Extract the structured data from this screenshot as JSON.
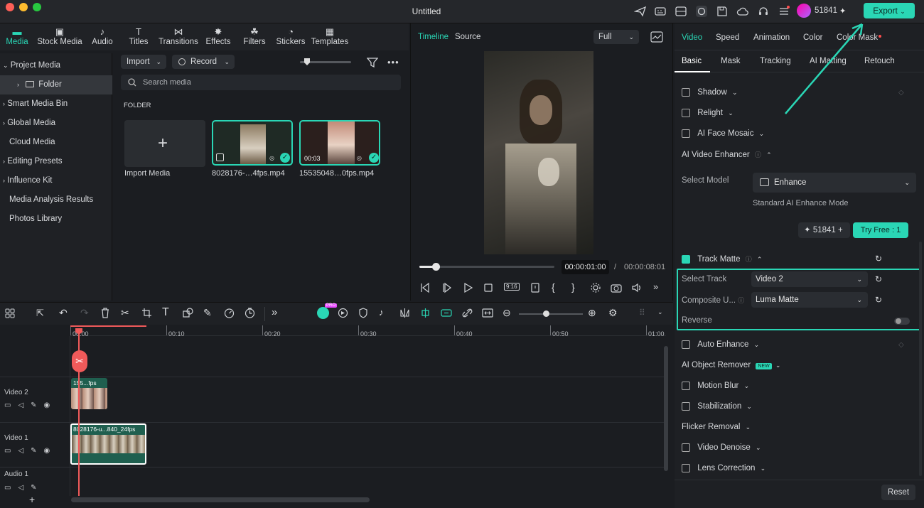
{
  "window": {
    "title": "Untitled",
    "credits": "51841",
    "export_label": "Export"
  },
  "media_tabs": [
    {
      "label": "Media",
      "icon": "folder-icon",
      "active": true
    },
    {
      "label": "Stock Media",
      "icon": "stock-icon"
    },
    {
      "label": "Audio",
      "icon": "music-icon"
    },
    {
      "label": "Titles",
      "icon": "text-icon"
    },
    {
      "label": "Transitions",
      "icon": "transition-icon"
    },
    {
      "label": "Effects",
      "icon": "effects-icon"
    },
    {
      "label": "Filters",
      "icon": "filters-icon"
    },
    {
      "label": "Stickers",
      "icon": "sticker-icon"
    },
    {
      "label": "Templates",
      "icon": "templates-icon"
    }
  ],
  "sidebar": [
    {
      "label": "Project Media"
    },
    {
      "label": "Folder"
    },
    {
      "label": "Smart Media Bin"
    },
    {
      "label": "Global Media"
    },
    {
      "label": "Cloud Media"
    },
    {
      "label": "Editing Presets"
    },
    {
      "label": "Influence Kit"
    },
    {
      "label": "Media Analysis Results"
    },
    {
      "label": "Photos Library"
    }
  ],
  "media": {
    "import_label": "Import",
    "record_label": "Record",
    "search_placeholder": "Search media",
    "folder_heading": "FOLDER",
    "import_media_label": "Import Media",
    "items": [
      {
        "name": "8028176-…4fps.mp4",
        "duration": ""
      },
      {
        "name": "15535048…0fps.mp4",
        "duration": "00:03"
      }
    ]
  },
  "player": {
    "tab_timeline": "Timeline",
    "tab_source": "Source",
    "quality": "Full",
    "current_time": "00:00:01:00",
    "separator": "/",
    "total_time": "00:00:08:01",
    "progress": 0.12
  },
  "inspector": {
    "top_tabs": [
      "Video",
      "Speed",
      "Animation",
      "Color",
      "Color Mask"
    ],
    "sub_tabs": [
      "Basic",
      "Mask",
      "Tracking",
      "AI Matting",
      "Retouch"
    ],
    "shadow": "Shadow",
    "relight": "Relight",
    "ai_face_mosaic": "AI Face Mosaic",
    "ai_video_enhancer": "AI Video Enhancer",
    "select_model_label": "Select Model",
    "model_value": "Enhance",
    "model_desc": "Standard AI Enhance Mode",
    "credits": "51841",
    "try_free": "Try Free : 1",
    "track_matte": "Track Matte",
    "select_track_label": "Select Track",
    "select_track_value": "Video 2",
    "composite_label": "Composite U...",
    "composite_value": "Luma Matte",
    "reverse_label": "Reverse",
    "auto_enhance": "Auto Enhance",
    "ai_object_remover": "AI Object Remover",
    "new_badge": "NEW",
    "motion_blur": "Motion Blur",
    "stabilization": "Stabilization",
    "flicker_removal": "Flicker Removal",
    "video_denoise": "Video Denoise",
    "lens_correction": "Lens Correction",
    "reset_label": "Reset"
  },
  "timeline": {
    "ticks": [
      "00:00",
      "00:10",
      "00:20",
      "00:30",
      "00:40",
      "00:50",
      "01:00"
    ],
    "tracks": [
      {
        "name": "Video 2",
        "clip": "155...fps"
      },
      {
        "name": "Video 1",
        "clip": "8028176-u...840_24fps"
      },
      {
        "name": "Audio 1",
        "clip": ""
      }
    ],
    "pro_badge": "PRO"
  },
  "colors": {
    "accent": "#2ad6b5",
    "playhead": "#f05a5a"
  }
}
